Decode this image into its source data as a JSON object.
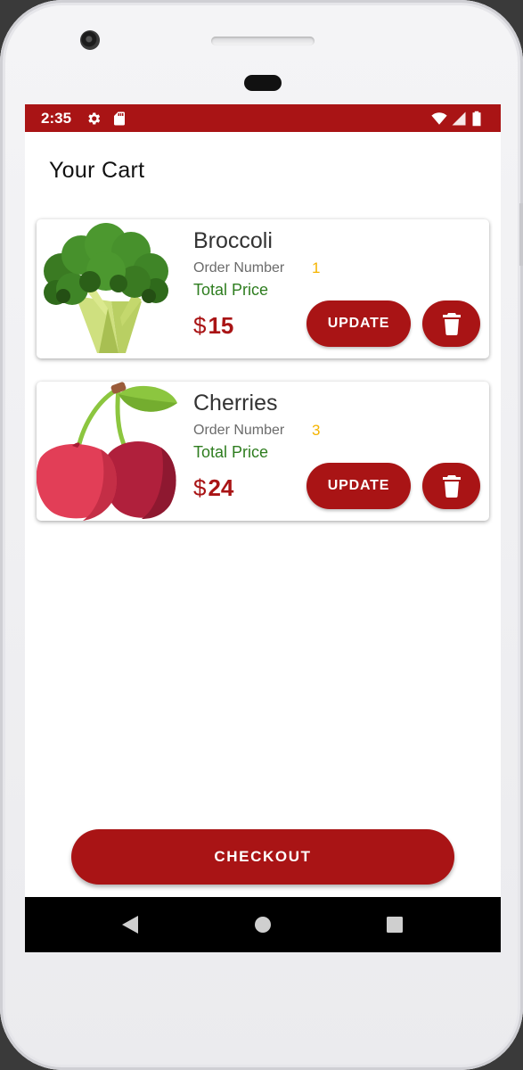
{
  "status_bar": {
    "time": "2:35",
    "icons": [
      "settings-gear-icon",
      "sd-card-icon",
      "wifi-icon",
      "signal-icon",
      "battery-icon"
    ],
    "color": "#a91415"
  },
  "page": {
    "title": "Your Cart"
  },
  "cart": {
    "items": [
      {
        "name": "Broccoli",
        "image": "broccoli-image",
        "order_label": "Order Number",
        "order_number": "1",
        "total_label": "Total Price",
        "currency": "$",
        "price": "15",
        "update_label": "UPDATE",
        "delete_icon": "trash-icon"
      },
      {
        "name": "Cherries",
        "image": "cherries-image",
        "order_label": "Order Number",
        "order_number": "3",
        "total_label": "Total Price",
        "currency": "$",
        "price": "24",
        "update_label": "UPDATE",
        "delete_icon": "trash-icon"
      }
    ]
  },
  "checkout": {
    "label": "CHECKOUT"
  },
  "nav_bar": {
    "icons": [
      "back-icon",
      "home-icon",
      "recents-icon"
    ]
  },
  "colors": {
    "primary": "#a91415",
    "order_number": "#f5b400",
    "total_label": "#2e7d1f"
  }
}
